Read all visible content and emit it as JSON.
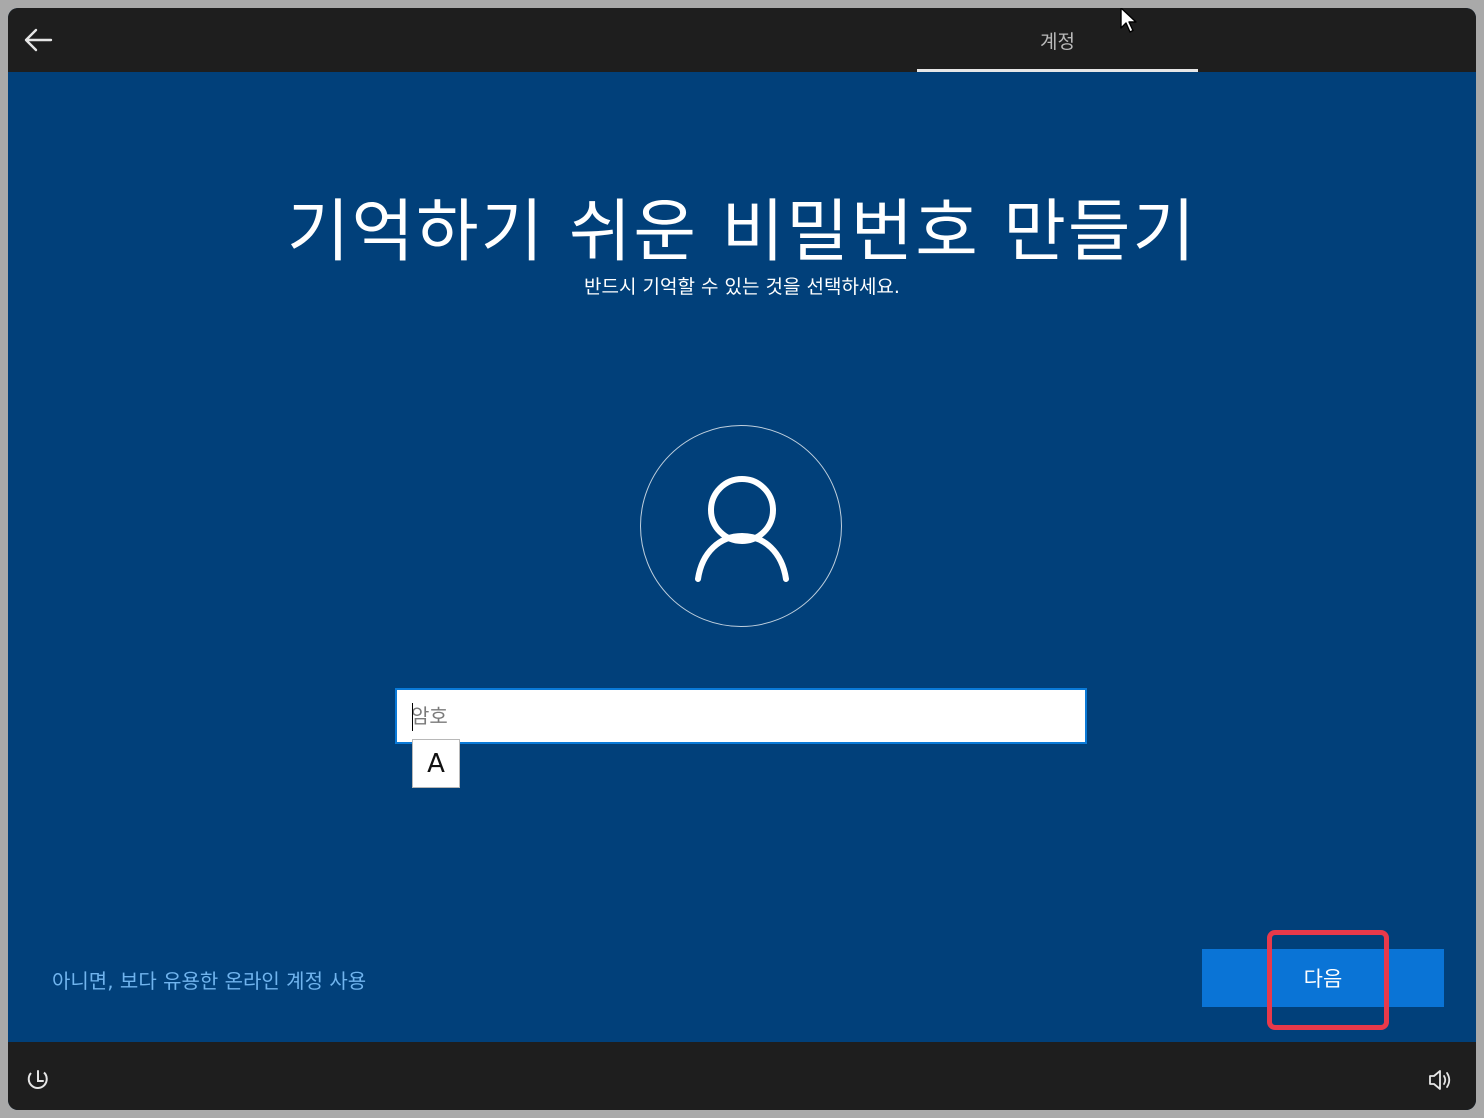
{
  "header": {
    "back_icon": "arrow-left-icon",
    "tab_label": "계정"
  },
  "main": {
    "title": "기억하기 쉬운 비밀번호 만들기",
    "subtitle": "반드시 기억할 수 있는 것을 선택하세요.",
    "avatar_icon": "user-icon",
    "password": {
      "value": "",
      "placeholder": "암호"
    },
    "ime_indicator": "A"
  },
  "footer": {
    "alt_link": "아니면, 보다 유용한 온라인 계정 사용",
    "next_label": "다음"
  },
  "bottombar": {
    "accessibility_icon": "accessibility-icon",
    "volume_icon": "volume-icon"
  },
  "colors": {
    "background": "#01407a",
    "bar": "#1e1e1e",
    "button": "#0a74d6",
    "link": "#70b4ee",
    "highlight": "#e8394a"
  }
}
